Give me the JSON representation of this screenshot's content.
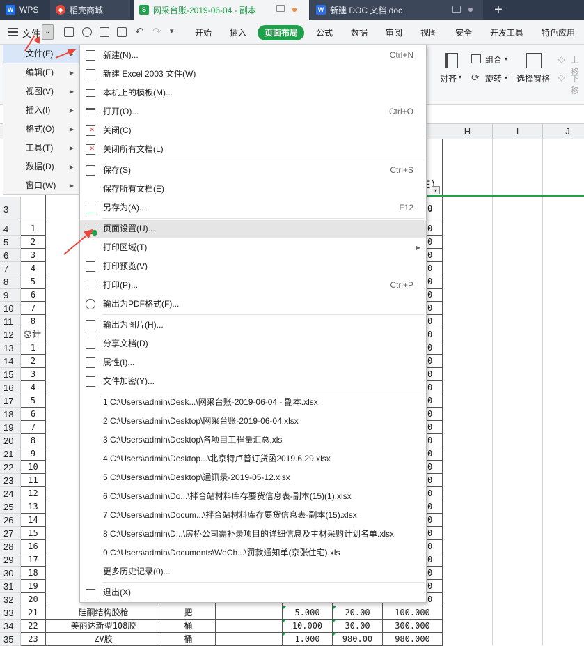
{
  "tabs": [
    {
      "label": "WPS",
      "icon": "wps-logo-icon"
    },
    {
      "label": "稻壳商城",
      "icon": "docer-icon"
    },
    {
      "label": "网采台账-2019-06-04 - 副本",
      "icon": "spreadsheet-icon"
    },
    {
      "label": "新建 DOC 文档.doc",
      "icon": "writer-icon"
    }
  ],
  "new_tab": "+",
  "toolbar": {
    "file_label": "文件",
    "menu_tabs": [
      "开始",
      "插入",
      "页面布局",
      "公式",
      "数据",
      "审阅",
      "视图",
      "安全",
      "开发工具",
      "特色应用"
    ],
    "active_tab": "页面布局"
  },
  "ribbon": {
    "align": "对齐",
    "group": "组合",
    "rotate": "旋转",
    "selection_pane": "选择窗格",
    "up": "上移",
    "down": "下移"
  },
  "left_menu": [
    {
      "label": "文件(F)"
    },
    {
      "label": "编辑(E)"
    },
    {
      "label": "视图(V)"
    },
    {
      "label": "插入(I)"
    },
    {
      "label": "格式(O)"
    },
    {
      "label": "工具(T)"
    },
    {
      "label": "数据(D)"
    },
    {
      "label": "窗口(W)"
    }
  ],
  "file_menu": {
    "new": {
      "label": "新建(N)...",
      "shortcut": "Ctrl+N"
    },
    "new_excel2003": {
      "label": "新建 Excel 2003 文件(W)"
    },
    "templates": {
      "label": "本机上的模板(M)..."
    },
    "open": {
      "label": "打开(O)...",
      "shortcut": "Ctrl+O"
    },
    "close": {
      "label": "关闭(C)"
    },
    "close_all": {
      "label": "关闭所有文档(L)"
    },
    "save": {
      "label": "保存(S)",
      "shortcut": "Ctrl+S"
    },
    "save_all": {
      "label": "保存所有文档(E)"
    },
    "save_as": {
      "label": "另存为(A)...",
      "shortcut": "F12"
    },
    "page_setup": {
      "label": "页面设置(U)..."
    },
    "print_area": {
      "label": "打印区域(T)"
    },
    "print_preview": {
      "label": "打印预览(V)"
    },
    "print": {
      "label": "打印(P)...",
      "shortcut": "Ctrl+P"
    },
    "export_pdf": {
      "label": "输出为PDF格式(F)..."
    },
    "export_image": {
      "label": "输出为图片(H)..."
    },
    "share": {
      "label": "分享文档(D)"
    },
    "properties": {
      "label": "属性(I)..."
    },
    "encrypt": {
      "label": "文件加密(Y)..."
    },
    "recent": [
      "1 C:\\Users\\admin\\Desk...\\网采台账-2019-06-04 - 副本.xlsx",
      "2 C:\\Users\\admin\\Desktop\\网采台账-2019-06-04.xlsx",
      "3 C:\\Users\\admin\\Desktop\\各项目工程量汇总.xls",
      "4 C:\\Users\\admin\\Desktop...\\北京特卢普订货函2019.6.29.xlsx",
      "5 C:\\Users\\admin\\Desktop\\通讯录-2019-05-12.xlsx",
      "6 C:\\Users\\admin\\Do...\\拌合站材料库存要货信息表-副本(15)(1).xlsx",
      "7 C:\\Users\\admin\\Docum...\\拌合站材料库存要货信息表-副本(15).xlsx",
      "8 C:\\Users\\admin\\D...\\房桥公司需补录项目的详细信息及主材采购计划名单.xlsx",
      "9 C:\\Users\\admin\\Documents\\WeCh...\\罚款通知单(京张住宅).xls"
    ],
    "more_history": {
      "label": "更多历史记录(0)..."
    },
    "exit": {
      "label": "退出(X)"
    }
  },
  "sheet": {
    "columns": [
      "H",
      "I",
      "J"
    ],
    "rows": [
      "3",
      "4",
      "5",
      "6",
      "7",
      "8",
      "9",
      "10",
      "11",
      "12",
      "13",
      "14",
      "15",
      "16",
      "17",
      "18",
      "19",
      "20",
      "21",
      "22",
      "23",
      "24",
      "25",
      "26",
      "27",
      "28",
      "29",
      "30",
      "31",
      "32",
      "33",
      "34",
      "35"
    ],
    "col_b_values": [
      "",
      "1",
      "2",
      "3",
      "4",
      "5",
      "6",
      "7",
      "8",
      "总计",
      "1",
      "2",
      "3",
      "4",
      "5",
      "6",
      "7",
      "8",
      "9",
      "10",
      "11",
      "12",
      "13",
      "14",
      "15",
      "16",
      "17",
      "18",
      "19",
      "20",
      "21",
      "22",
      "23"
    ],
    "right_fragments": [
      "0",
      "0",
      "0",
      "0",
      "0",
      "0",
      "0",
      "0",
      "0",
      "0",
      "0",
      "0",
      "0",
      "0",
      "0",
      "0",
      "0",
      "0",
      "0",
      "0",
      "0",
      "0",
      "0",
      "0",
      "0",
      "0",
      "0",
      "0",
      "0"
    ],
    "header_fragment": "E)",
    "bottom_rows": [
      {
        "name": "硅酮结构胶枪",
        "unit": "把",
        "qty": "5.000",
        "price": "20.00",
        "amount": "100.000"
      },
      {
        "name": "美丽达新型108胶",
        "unit": "桶",
        "qty": "10.000",
        "price": "30.00",
        "amount": "300.000"
      },
      {
        "name": "ZV胶",
        "unit": "桶",
        "qty": "1.000",
        "price": "980.00",
        "amount": "980.000"
      }
    ]
  },
  "colors": {
    "accent_green": "#1fa04a",
    "annotation_red": "#e8473c",
    "titlebar": "#2f3a4c"
  }
}
